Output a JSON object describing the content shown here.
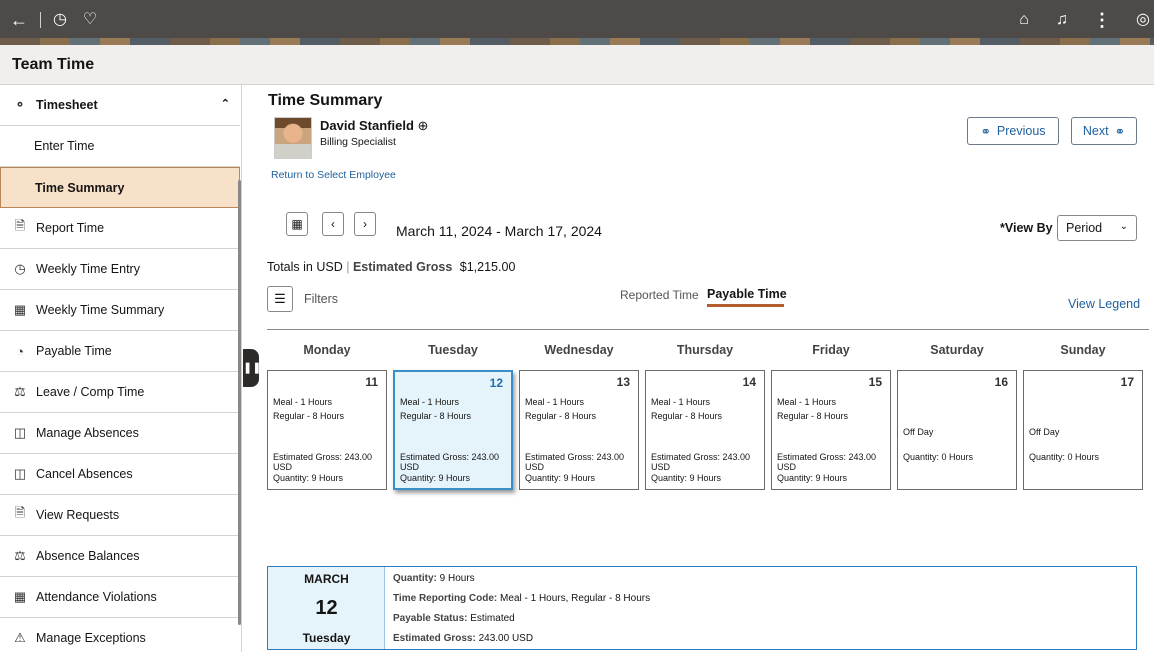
{
  "header": {
    "icons": [
      "back-arrow-icon",
      "history-icon",
      "heart-icon",
      "home-icon",
      "notification-bell-icon",
      "more-icon",
      "compass-icon"
    ]
  },
  "page_title": "Team Time",
  "sidebar": {
    "section": "Timesheet",
    "items": [
      {
        "label": "Enter Time",
        "icon": ""
      },
      {
        "label": "Time Summary",
        "icon": "",
        "active": true
      },
      {
        "label": "Report Time",
        "icon": "report-time-icon"
      },
      {
        "label": "Weekly Time Entry",
        "icon": "weekly-time-entry-icon"
      },
      {
        "label": "Weekly Time Summary",
        "icon": "weekly-time-summary-icon"
      },
      {
        "label": "Payable Time",
        "icon": "payable-time-icon"
      },
      {
        "label": "Leave / Comp Time",
        "icon": "leave-icon"
      },
      {
        "label": "Manage Absences",
        "icon": "manage-absences-icon"
      },
      {
        "label": "Cancel Absences",
        "icon": "cancel-absences-icon"
      },
      {
        "label": "View Requests",
        "icon": "view-requests-icon"
      },
      {
        "label": "Absence Balances",
        "icon": "absence-balances-icon"
      },
      {
        "label": "Attendance Violations",
        "icon": "attendance-violations-icon"
      },
      {
        "label": "Manage Exceptions",
        "icon": "warning-icon"
      }
    ]
  },
  "main": {
    "title": "Time Summary",
    "employee": {
      "name": "David Stanfield",
      "role": "Billing Specialist"
    },
    "return_link": "Return to Select Employee",
    "previous_label": "Previous",
    "next_label": "Next",
    "date_range": "March 11, 2024 - March 17, 2024",
    "view_by_label": "*View By",
    "view_by_value": "Period",
    "totals_prefix": "Totals in USD",
    "totals_label": "Estimated Gross",
    "totals_value": "$1,215.00",
    "filters_label": "Filters",
    "tab_reported": "Reported Time",
    "tab_payable": "Payable Time",
    "view_legend": "View Legend",
    "days": [
      {
        "name": "Monday",
        "num": "11",
        "lines": [
          "Meal - 1 Hours",
          "Regular - 8 Hours"
        ],
        "gross1": "Estimated Gross: 243.00",
        "gross2": "USD",
        "qty": "Quantity: 9 Hours"
      },
      {
        "name": "Tuesday",
        "num": "12",
        "lines": [
          "Meal - 1 Hours",
          "Regular - 8 Hours"
        ],
        "gross1": "Estimated Gross: 243.00",
        "gross2": "USD",
        "qty": "Quantity: 9 Hours"
      },
      {
        "name": "Wednesday",
        "num": "13",
        "lines": [
          "Meal - 1 Hours",
          "Regular - 8 Hours"
        ],
        "gross1": "Estimated Gross: 243.00",
        "gross2": "USD",
        "qty": "Quantity: 9 Hours"
      },
      {
        "name": "Thursday",
        "num": "14",
        "lines": [
          "Meal - 1 Hours",
          "Regular - 8 Hours"
        ],
        "gross1": "Estimated Gross: 243.00",
        "gross2": "USD",
        "qty": "Quantity: 9 Hours"
      },
      {
        "name": "Friday",
        "num": "15",
        "lines": [
          "Meal - 1 Hours",
          "Regular - 8 Hours"
        ],
        "gross1": "Estimated Gross: 243.00",
        "gross2": "USD",
        "qty": "Quantity: 9 Hours"
      },
      {
        "name": "Saturday",
        "num": "16",
        "off": "Off Day",
        "qty": "Quantity: 0 Hours"
      },
      {
        "name": "Sunday",
        "num": "17",
        "off": "Off Day",
        "qty": "Quantity: 0 Hours"
      }
    ],
    "detail": {
      "month": "MARCH",
      "day": "12",
      "weekday": "Tuesday",
      "quantity_label": "Quantity:",
      "quantity_value": "9 Hours",
      "trc_label": "Time Reporting Code:",
      "trc_value": "Meal - 1 Hours, Regular - 8 Hours",
      "status_label": "Payable Status:",
      "status_value": "Estimated",
      "gross_label": "Estimated Gross:",
      "gross_value": "243.00 USD"
    }
  },
  "colors": {
    "accent": "#1f5f9e",
    "active_item": "#f7e1c9",
    "tab_underline": "#b35c2e",
    "selected_day": "#e5f3fb"
  }
}
